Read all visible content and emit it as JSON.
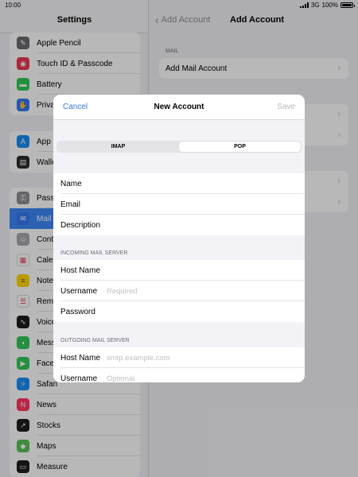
{
  "status": {
    "time": "10:00",
    "network": "3G",
    "battery": "100%"
  },
  "sidebar": {
    "title": "Settings",
    "group1": [
      {
        "label": "Apple Pencil",
        "icon": "pencil-icon",
        "color": "#6b6b70"
      },
      {
        "label": "Touch ID & Passcode",
        "icon": "fingerprint-icon",
        "color": "#e8384f"
      },
      {
        "label": "Battery",
        "icon": "battery-icon",
        "color": "#34c759"
      },
      {
        "label": "Privacy",
        "icon": "hand-icon",
        "color": "#3478f6"
      }
    ],
    "group2": [
      {
        "label": "App Store",
        "icon": "app-store-icon",
        "color": "#1a8cf5"
      },
      {
        "label": "Wallet",
        "icon": "wallet-icon",
        "color": "#2b2b2b"
      }
    ],
    "group3": [
      {
        "label": "Passwords",
        "icon": "key-icon",
        "color": "#8e8e93"
      },
      {
        "label": "Mail",
        "icon": "mail-icon",
        "color": "#3478f6",
        "selected": true
      },
      {
        "label": "Contacts",
        "icon": "contacts-icon",
        "color": "#a8a8ad"
      },
      {
        "label": "Calendar",
        "icon": "calendar-icon",
        "color": "#ffffff"
      },
      {
        "label": "Notes",
        "icon": "notes-icon",
        "color": "#ffd60a"
      },
      {
        "label": "Reminders",
        "icon": "reminders-icon",
        "color": "#ffffff"
      },
      {
        "label": "Voice Memos",
        "icon": "voice-memos-icon",
        "color": "#1c1c1e"
      },
      {
        "label": "Messages",
        "icon": "messages-icon",
        "color": "#34c759"
      },
      {
        "label": "FaceTime",
        "icon": "facetime-icon",
        "color": "#34c759"
      },
      {
        "label": "Safari",
        "icon": "safari-icon",
        "color": "#1a8cf5"
      },
      {
        "label": "News",
        "icon": "news-icon",
        "color": "#ff375f"
      },
      {
        "label": "Stocks",
        "icon": "stocks-icon",
        "color": "#1c1c1e"
      },
      {
        "label": "Maps",
        "icon": "maps-icon",
        "color": "#5ac05a"
      },
      {
        "label": "Measure",
        "icon": "measure-icon",
        "color": "#1c1c1e"
      }
    ]
  },
  "detail": {
    "back_label": "Add Account",
    "title": "Add Account",
    "section_mail": "MAIL",
    "add_mail_account": "Add Mail Account"
  },
  "modal": {
    "cancel": "Cancel",
    "title": "New Account",
    "save": "Save",
    "segments": [
      "IMAP",
      "POP"
    ],
    "selected_segment": "POP",
    "account_fields": [
      {
        "label": "Name",
        "placeholder": ""
      },
      {
        "label": "Email",
        "placeholder": ""
      },
      {
        "label": "Description",
        "placeholder": ""
      }
    ],
    "incoming_label": "INCOMING MAIL SERVER",
    "incoming_fields": [
      {
        "label": "Host Name",
        "placeholder": ""
      },
      {
        "label": "Username",
        "placeholder": "Required"
      },
      {
        "label": "Password",
        "placeholder": ""
      }
    ],
    "outgoing_label": "OUTGOING MAIL SERVER",
    "outgoing_fields": [
      {
        "label": "Host Name",
        "placeholder": "smtp.example.com"
      },
      {
        "label": "Username",
        "placeholder": "Optional"
      }
    ]
  }
}
